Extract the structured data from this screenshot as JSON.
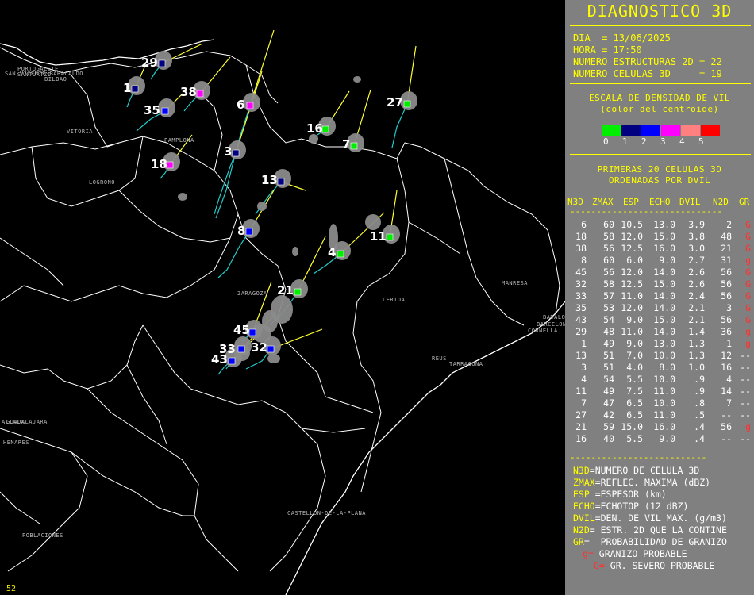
{
  "panel": {
    "title": "DIAGNOSTICO 3D",
    "info": {
      "dia": "DIA  = 13/06/2025",
      "hora": "HORA = 17:50",
      "n2d": "NUMERO ESTRUCTURAS 2D = 22",
      "n3d": "NUMERO CELULAS 3D     = 19"
    },
    "scale_title_1": "ESCALA DE DENSIDAD DE VIL",
    "scale_title_2": "(color del centroide)",
    "scale_colors": [
      "#00ee00",
      "#000080",
      "#0000ff",
      "#ff00ff",
      "#ff8080",
      "#ff0000"
    ],
    "scale_labels": [
      "0",
      "1",
      "2",
      "3",
      "4",
      "5"
    ],
    "ranking_title_1": "PRIMERAS 20 CELULAS 3D",
    "ranking_title_2": "ORDENADAS POR DVIL",
    "table_headers": [
      "N3D",
      "ZMAX",
      "ESP",
      "ECHO",
      "DVIL",
      "N2D",
      "GR"
    ],
    "dashes": "-----------------------------",
    "rows": [
      [
        "6",
        "60",
        "10.5",
        "13.0",
        "3.9",
        "2",
        "G"
      ],
      [
        "18",
        "58",
        "12.0",
        "15.0",
        "3.8",
        "48",
        "G"
      ],
      [
        "38",
        "56",
        "12.5",
        "16.0",
        "3.0",
        "21",
        "G"
      ],
      [
        "8",
        "60",
        "6.0",
        "9.0",
        "2.7",
        "31",
        "g"
      ],
      [
        "45",
        "56",
        "12.0",
        "14.0",
        "2.6",
        "56",
        "G"
      ],
      [
        "32",
        "58",
        "12.5",
        "15.0",
        "2.6",
        "56",
        "G"
      ],
      [
        "33",
        "57",
        "11.0",
        "14.0",
        "2.4",
        "56",
        "G"
      ],
      [
        "35",
        "53",
        "12.0",
        "14.0",
        "2.1",
        "3",
        "G"
      ],
      [
        "43",
        "54",
        "9.0",
        "15.0",
        "2.1",
        "56",
        "G"
      ],
      [
        "29",
        "48",
        "11.0",
        "14.0",
        "1.4",
        "36",
        "g"
      ],
      [
        "1",
        "49",
        "9.0",
        "13.0",
        "1.3",
        "1",
        "g"
      ],
      [
        "13",
        "51",
        "7.0",
        "10.0",
        "1.3",
        "12",
        "--"
      ],
      [
        "3",
        "51",
        "4.0",
        "8.0",
        "1.0",
        "16",
        "--"
      ],
      [
        "4",
        "54",
        "5.5",
        "10.0",
        ".9",
        "4",
        "--"
      ],
      [
        "11",
        "49",
        "7.5",
        "11.0",
        ".9",
        "14",
        "--"
      ],
      [
        "7",
        "47",
        "6.5",
        "10.0",
        ".8",
        "7",
        "--"
      ],
      [
        "27",
        "42",
        "6.5",
        "11.0",
        ".5",
        "--",
        "--"
      ],
      [
        "21",
        "59",
        "15.0",
        "16.0",
        ".4",
        "56",
        "g"
      ],
      [
        "16",
        "40",
        "5.5",
        "9.0",
        ".4",
        "--",
        "--"
      ]
    ],
    "legend_dashes": "--------------------------",
    "legend": [
      {
        "k": "N3D",
        "v": "=NUMERO DE CELULA 3D"
      },
      {
        "k": "ZMAX",
        "v": "=REFLEC. MAXIMA (dBZ)"
      },
      {
        "k": "ESP",
        "v": " =ESPESOR (km)"
      },
      {
        "k": "ECHO",
        "v": "=ECHOTOP (12 dBZ)"
      },
      {
        "k": "DVIL",
        "v": "=DEN. DE VIL MAX. (g/m3)"
      },
      {
        "k": "N2D",
        "v": "= ESTR. 2D QUE LA CONTINE"
      },
      {
        "k": "GR",
        "v": "=  PROBABILIDAD DE GRANIZO"
      }
    ],
    "legend_g1_key": "g=",
    "legend_g1_val": " GRANIZO PROBABLE",
    "legend_g2_key": "G=",
    "legend_g2_val": " GR. SEVERO PROBABLE"
  },
  "map": {
    "frame_number": "52",
    "cities": [
      "PORTUGALETE",
      "SANTURTZI",
      "SAN-VICENTE-BARACALDO",
      "BILBAO",
      "VITORIA",
      "PAMPLONA",
      "LOGRONO",
      "ZARAGOZA",
      "LERIDA",
      "MANRESA",
      "BADALONA",
      "BARCELONA",
      "CORNELLA",
      "REUS",
      "TARRAGONA",
      "ALCALA",
      "GUADALAJARA",
      "HENARES",
      "CASTELLON-DE-LA-PLANA",
      "POBLACIONES"
    ],
    "cells": [
      {
        "id": "29",
        "color": "#000080"
      },
      {
        "id": "1",
        "color": "#000080"
      },
      {
        "id": "35",
        "color": "#0000ff"
      },
      {
        "id": "38",
        "color": "#ff00ff"
      },
      {
        "id": "6",
        "color": "#ff00ff"
      },
      {
        "id": "16",
        "color": "#00ee00"
      },
      {
        "id": "27",
        "color": "#00ee00"
      },
      {
        "id": "7",
        "color": "#00ee00"
      },
      {
        "id": "3",
        "color": "#000080"
      },
      {
        "id": "18",
        "color": "#ff00ff"
      },
      {
        "id": "13",
        "color": "#000080"
      },
      {
        "id": "8",
        "color": "#0000ff"
      },
      {
        "id": "11",
        "color": "#00ee00"
      },
      {
        "id": "4",
        "color": "#00ee00"
      },
      {
        "id": "21",
        "color": "#00ee00"
      },
      {
        "id": "45",
        "color": "#0000ff"
      },
      {
        "id": "33",
        "color": "#0000ff"
      },
      {
        "id": "32",
        "color": "#0000ff"
      },
      {
        "id": "43",
        "color": "#0000ff"
      }
    ]
  }
}
